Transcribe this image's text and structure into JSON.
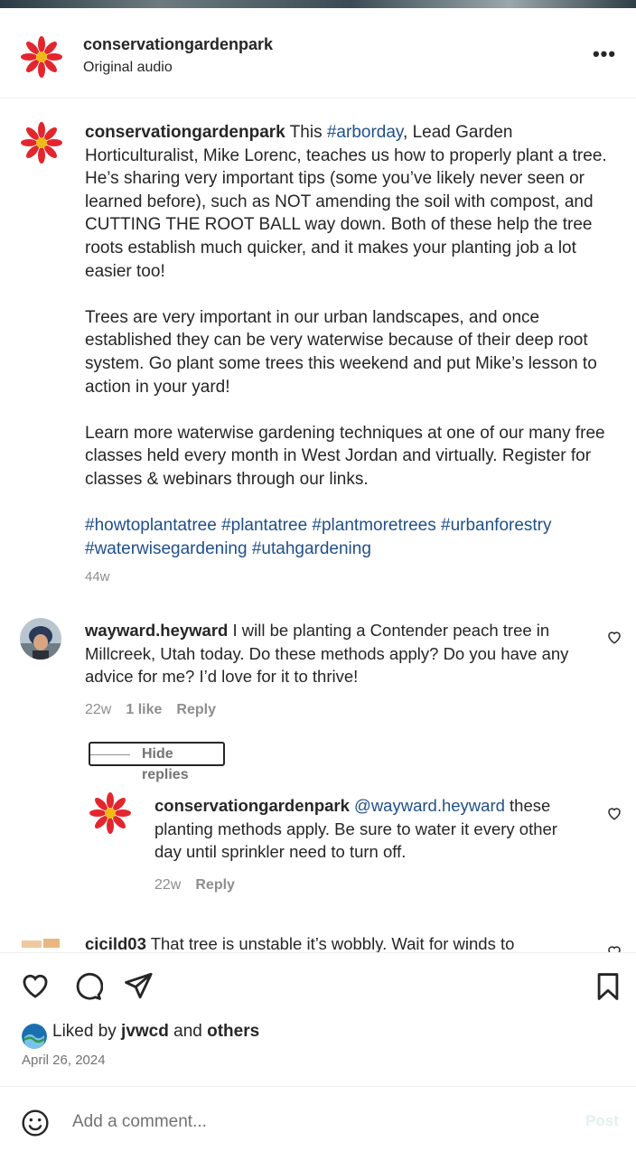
{
  "post": {
    "username": "conservationgardenpark",
    "audio": "Original audio"
  },
  "caption": {
    "username": "conservationgardenpark",
    "intro": " This ",
    "tag_arborday": "#arborday",
    "p1_rest": ", Lead Garden Horticulturalist, Mike Lorenc, teaches us how to properly plant a tree. He’s sharing very important tips (some you’ve likely never seen or learned before), such as NOT amending the soil with compost, and CUTTING THE ROOT BALL way down. Both of these help the tree roots establish much quicker, and it makes your planting job a lot easier too!",
    "p2": "Trees are very important in our urban landscapes, and once established they can be very waterwise because of their deep root system. Go plant some trees this weekend and put Mike’s lesson to action in your yard!",
    "p3": "Learn more waterwise gardening techniques at one of our many free classes held every month in West Jordan and virtually. Register for classes & webinars through our links.",
    "hashtags": [
      "#howtoplantatree",
      "#plantatree",
      "#plantmoretrees",
      "#urbanforestry",
      "#waterwisegardening",
      "#utahgardening"
    ],
    "time": "44w"
  },
  "comments": [
    {
      "username": "wayward.heyward",
      "text": " I will be planting a Contender peach tree in Millcreek, Utah today. Do these methods apply? Do you have any advice for me? I’d love for it to thrive!",
      "time": "22w",
      "likes": "1 like",
      "reply": "Reply"
    },
    {
      "username": "cicild03",
      "text": " That tree is unstable it’s wobbly. Wait for winds to"
    }
  ],
  "hide_replies": "Hide replies",
  "reply": {
    "username": "conservationgardenpark",
    "mention": "@wayward.heyward",
    "text": " these planting methods apply. Be sure to water it every other day until sprinkler need to turn off.",
    "time": "22w",
    "reply": "Reply"
  },
  "likes": {
    "prefix": "Liked by ",
    "user": "jvwcd",
    "mid": " and ",
    "others": "others"
  },
  "date": "April 26, 2024",
  "add_comment": {
    "placeholder": "Add a comment...",
    "post": "Post"
  },
  "colors": {
    "hashtag": "#1f4f8b",
    "secondary": "#8e8e8e",
    "flower": "#e3262d"
  }
}
